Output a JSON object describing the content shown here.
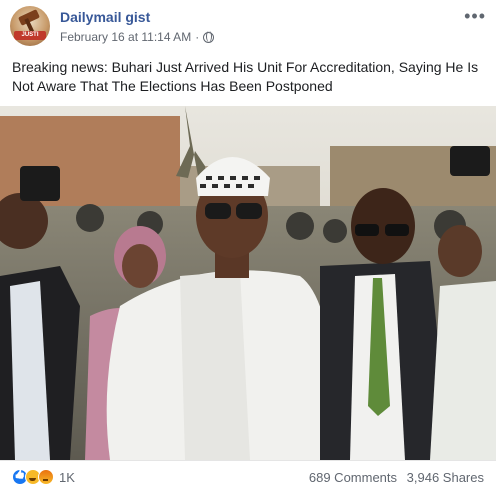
{
  "post": {
    "page_name": "Dailymail gist",
    "avatar_text": "JUSTI",
    "timestamp": "February 16 at 11:14 AM",
    "separator": "·",
    "more_label": "•••",
    "caption": "Breaking news: Buhari Just Arrived His Unit For Accreditation, Saying He Is Not Aware That The Elections Has Been Postponed",
    "reactions": {
      "icons": [
        "like-icon",
        "haha-icon",
        "angry-icon"
      ],
      "count": "1K"
    },
    "comments": "689 Comments",
    "shares": "3,946 Shares"
  },
  "colors": {
    "page_name": "#385898",
    "meta": "#616770",
    "like": "#1877f2"
  }
}
